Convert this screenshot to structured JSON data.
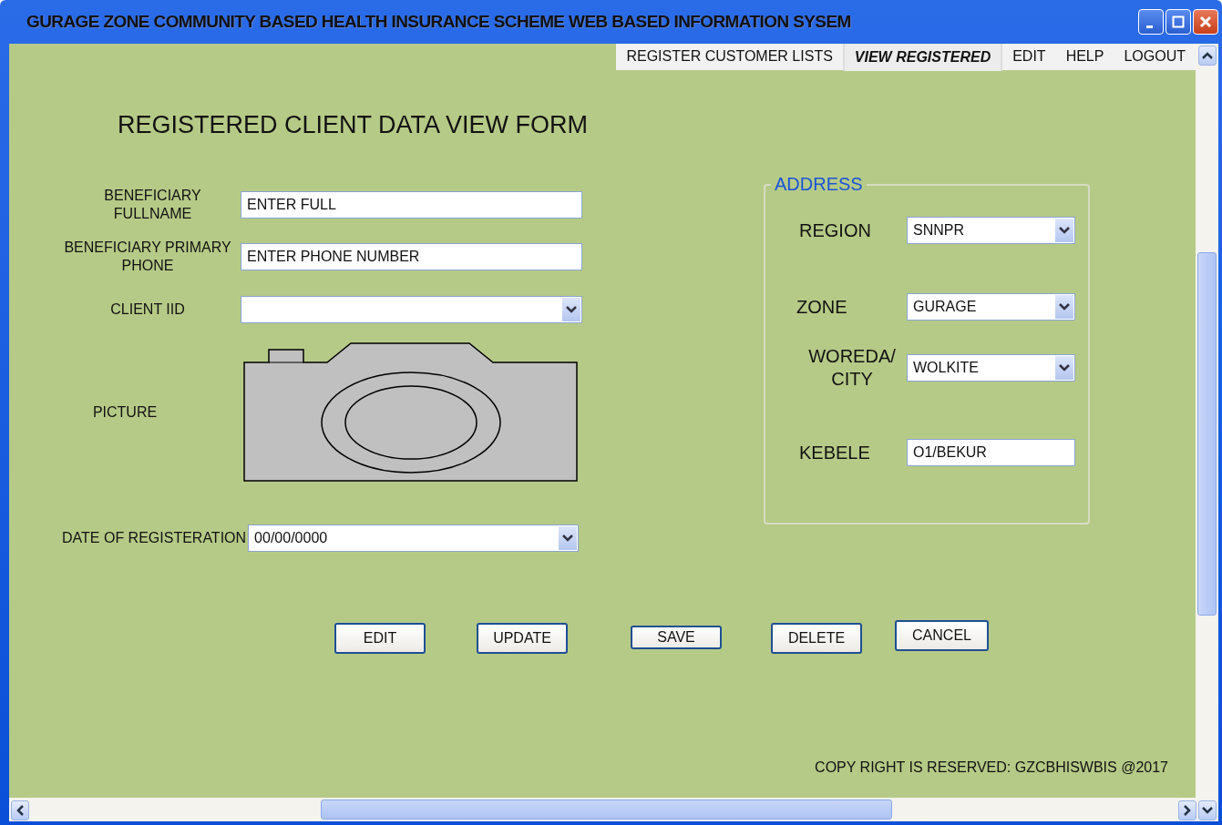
{
  "window": {
    "title": "GURAGE ZONE COMMUNITY BASED HEALTH INSURANCE SCHEME WEB BASED INFORMATION SYSEM"
  },
  "menu": [
    {
      "label": "REGISTER CUSTOMER LISTS",
      "selected": false
    },
    {
      "label": "VIEW REGISTERED",
      "selected": true
    },
    {
      "label": "EDIT",
      "selected": false
    },
    {
      "label": "HELP",
      "selected": false
    },
    {
      "label": "LOGOUT",
      "selected": false
    }
  ],
  "form_title": "REGISTERED CLIENT DATA VIEW FORM",
  "fields": [
    {
      "label": "BENEFICIARY FULLNAME",
      "kind": "text",
      "value": "ENTER FULL"
    },
    {
      "label": "BENEFICIARY PRIMARY PHONE",
      "kind": "text",
      "value": "ENTER PHONE NUMBER"
    },
    {
      "label": "CLIENT IID",
      "kind": "dropdown"
    },
    {
      "label": "PICTURE",
      "kind": "picture"
    },
    {
      "label": "DATE OF REGISTERATION",
      "kind": "dropdown",
      "value": "00/00/0000"
    }
  ],
  "address": {
    "legend": "ADDRESS",
    "fields": [
      {
        "label": "REGION",
        "kind": "dropdown",
        "value": "SNNPR"
      },
      {
        "label": "ZONE",
        "kind": "dropdown",
        "value": "GURAGE"
      },
      {
        "label": "WOREDA/ CITY",
        "kind": "dropdown",
        "value": "WOLKITE"
      },
      {
        "label": "KEBELE",
        "kind": "text",
        "value": "O1/BEKUR"
      }
    ]
  },
  "buttons": [
    "EDIT",
    "UPDATE",
    "SAVE",
    "DELETE",
    "CANCEL"
  ],
  "copyright": "COPY  RIGHT IS RESERVED: GZCBHISWBIS @2017"
}
